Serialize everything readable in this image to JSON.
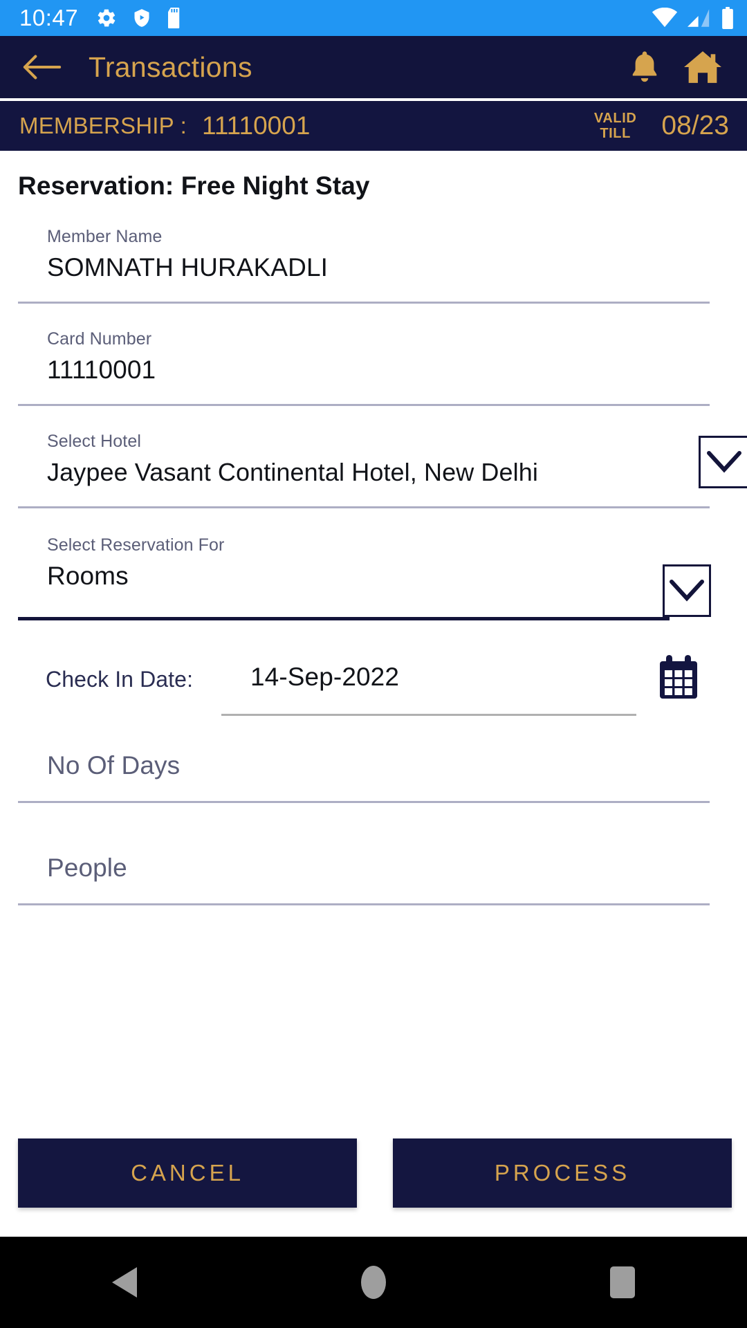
{
  "status_bar": {
    "time": "10:47",
    "left_icons": [
      "gear-icon",
      "shield-play-icon",
      "sd-card-icon"
    ],
    "right_icons": [
      "wifi-icon",
      "signal-icon",
      "battery-icon"
    ],
    "background_color": "#2196f3"
  },
  "app_bar": {
    "back_icon": "arrow-left-icon",
    "title": "Transactions",
    "notification_icon": "bell-icon",
    "home_icon": "home-icon",
    "background_color": "#12143c",
    "accent_color": "#d6a44e"
  },
  "membership_bar": {
    "label": "MEMBERSHIP :",
    "number": "11110001",
    "valid_till_line1": "VALID",
    "valid_till_line2": "TILL",
    "valid_till_date": "08/23"
  },
  "form": {
    "title": "Reservation: Free Night Stay",
    "fields": [
      {
        "label": "Member Name",
        "value": "SOMNATH HURAKADLI"
      },
      {
        "label": "Card Number",
        "value": "11110001"
      },
      {
        "label": "Select Hotel",
        "value": "Jaypee Vasant Continental Hotel, New Delhi"
      },
      {
        "label": "Select Reservation For",
        "value": "Rooms"
      }
    ],
    "check_in": {
      "label": "Check In Date:",
      "value": "14-Sep-2022",
      "calendar_icon": "calendar-icon"
    },
    "placeholders": [
      {
        "text": "No Of Days"
      },
      {
        "text": "People"
      }
    ],
    "dropdown_icon": "chevron-down-icon"
  },
  "actions": {
    "cancel_label": "CANCEL",
    "process_label": "PROCESS",
    "button_color": "#141640",
    "button_text_color": "#d6a44e"
  },
  "nav_bar": {
    "back_icon": "triangle-back-icon",
    "home_icon": "circle-home-icon",
    "recents_icon": "square-recents-icon"
  }
}
